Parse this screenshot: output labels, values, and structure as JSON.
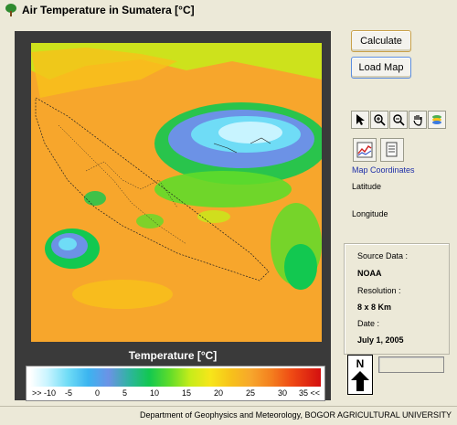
{
  "window": {
    "title": "Air Temperature in Sumatera [°C]"
  },
  "buttons": {
    "calculate": "Calculate",
    "load_map": "Load Map"
  },
  "toolbar": {
    "tools": [
      "pointer-icon",
      "zoom-in-icon",
      "zoom-out-icon",
      "pan-hand-icon",
      "layers-icon"
    ]
  },
  "panel": {
    "map_coordinates": "Map Coordinates",
    "latitude": "Latitude",
    "longitude": "Longitude"
  },
  "info": {
    "source_label": "Source Data :",
    "source_value": "NOAA",
    "resolution_label": "Resolution :",
    "resolution_value": "8 x 8 Km",
    "date_label": "Date :",
    "date_value": "July 1, 2005"
  },
  "legend": {
    "title": "Temperature [°C]",
    "ticks": [
      ">> -10",
      "-5",
      "0",
      "5",
      "10",
      "15",
      "20",
      "25",
      "30",
      "35 <<"
    ],
    "colors": {
      "cold": "#ffffff",
      "mid_blue": "#6c92e6",
      "green": "#12c850",
      "yellow": "#f7e61a",
      "orange": "#f7a62c",
      "hot": "#d40f0f"
    }
  },
  "compass": {
    "north": "N"
  },
  "footer": {
    "credit": "Department of Geophysics and Meteorology, BOGOR AGRICULTURAL UNIVERSITY"
  }
}
